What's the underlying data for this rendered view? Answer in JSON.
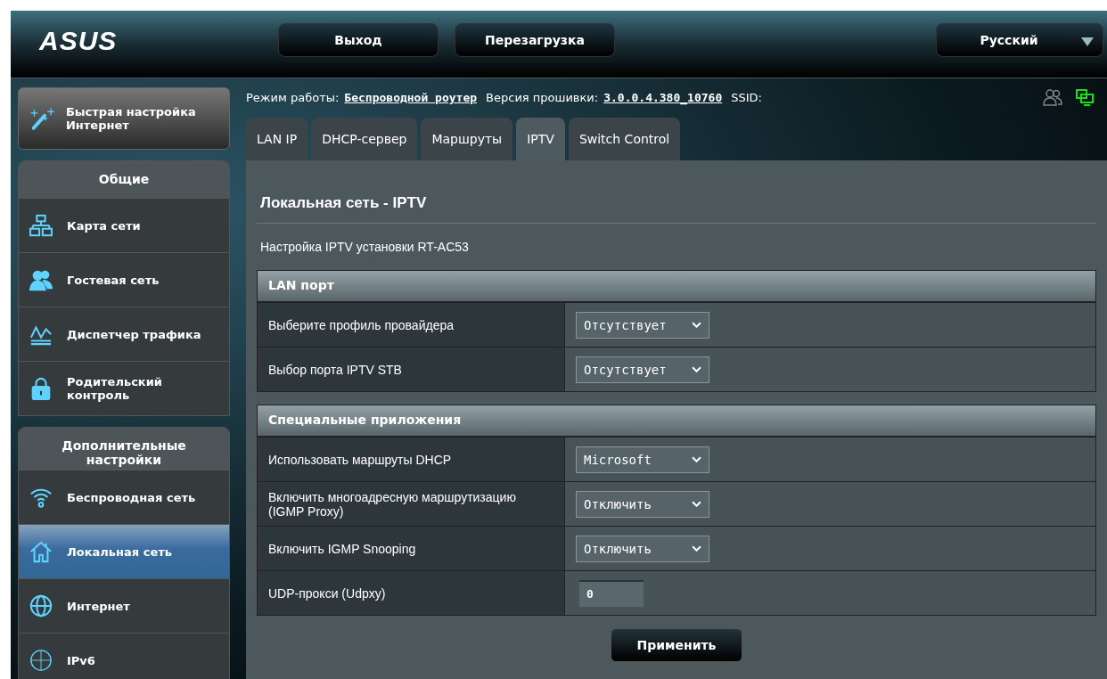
{
  "header": {
    "logo": "ASUS",
    "buttons": [
      "Выход",
      "Перезагрузка"
    ],
    "language": "Русский"
  },
  "quick_setup": "Быстрая настройка Интернет",
  "sidebar": [
    {
      "title": "Общие",
      "items": [
        {
          "label": "Карта сети",
          "selected": false
        },
        {
          "label": "Гостевая сеть",
          "selected": false
        },
        {
          "label": "Диспетчер трафика",
          "selected": false
        },
        {
          "label": "Родительский контроль",
          "selected": false
        }
      ]
    },
    {
      "title": "Дополнительные настройки",
      "items": [
        {
          "label": "Беспроводная сеть",
          "selected": false
        },
        {
          "label": "Локальная сеть",
          "selected": true
        },
        {
          "label": "Интернет",
          "selected": false
        },
        {
          "label": "IPv6",
          "selected": false
        }
      ]
    }
  ],
  "status": {
    "mode_label": "Режим работы:",
    "mode": "Беспроводной роутер",
    "firmware_label": "Версия прошивки:",
    "firmware": "3.0.0.4.380_10760",
    "ssid_label": "SSID:"
  },
  "tabs": [
    {
      "label": "LAN IP",
      "selected": false
    },
    {
      "label": "DHCP-сервер",
      "selected": false
    },
    {
      "label": "Маршруты",
      "selected": false
    },
    {
      "label": "IPTV",
      "selected": true
    },
    {
      "label": "Switch Control",
      "selected": false
    }
  ],
  "page_title": "Локальная сеть - IPTV",
  "description": "Настройка IPTV установки RT-AC53",
  "sections": [
    {
      "title": "LAN порт",
      "rows": [
        {
          "label": "Выберите профиль провайдера",
          "kind": "select",
          "value": "Отсутствует"
        },
        {
          "label": "Выбор порта IPTV STB",
          "kind": "select",
          "value": "Отсутствует"
        }
      ]
    },
    {
      "title": "Специальные приложения",
      "rows": [
        {
          "label": "Использовать маршруты DHCP",
          "kind": "select",
          "value": "Microsoft"
        },
        {
          "label": "Включить многоадресную маршрутизацию (IGMP Proxy)",
          "kind": "select",
          "value": "Отключить"
        },
        {
          "label": "Включить IGMP Snooping",
          "kind": "select",
          "value": "Отключить"
        },
        {
          "label": "UDP-прокси (Udpxy)",
          "kind": "input",
          "value": "0"
        }
      ]
    }
  ],
  "apply": "Применить"
}
